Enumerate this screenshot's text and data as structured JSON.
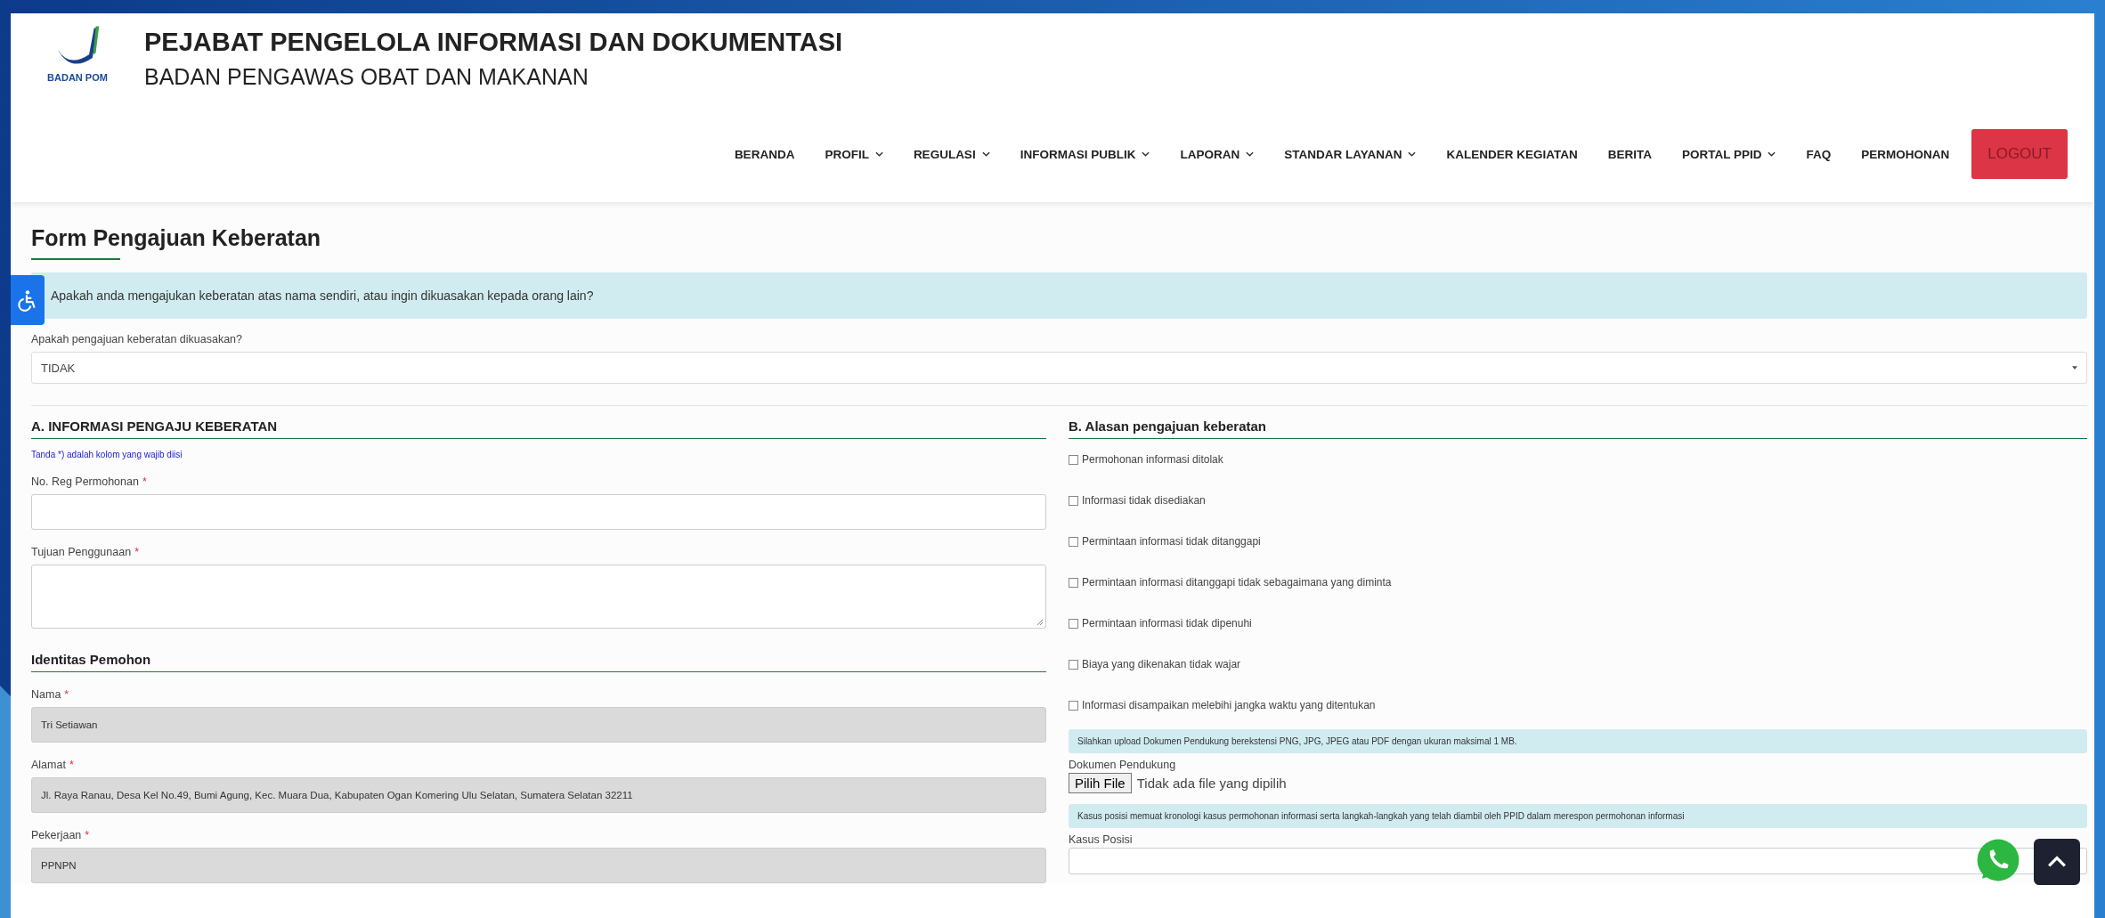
{
  "header": {
    "logo_text": "BADAN POM",
    "title": "PEJABAT PENGELOLA INFORMASI DAN DOKUMENTASI",
    "subtitle": "BADAN PENGAWAS OBAT DAN MAKANAN"
  },
  "nav": [
    {
      "label": "BERANDA",
      "dropdown": false
    },
    {
      "label": "PROFIL",
      "dropdown": true
    },
    {
      "label": "REGULASI",
      "dropdown": true
    },
    {
      "label": "INFORMASI PUBLIK",
      "dropdown": true
    },
    {
      "label": "LAPORAN",
      "dropdown": true
    },
    {
      "label": "STANDAR LAYANAN",
      "dropdown": true
    },
    {
      "label": "KALENDER KEGIATAN",
      "dropdown": false
    },
    {
      "label": "BERITA",
      "dropdown": false
    },
    {
      "label": "PORTAL PPID",
      "dropdown": true
    },
    {
      "label": "FAQ",
      "dropdown": false
    },
    {
      "label": "PERMOHONAN",
      "dropdown": false
    }
  ],
  "logout": "LOGOUT",
  "form_title": "Form Pengajuan Keberatan",
  "intro_alert": "Apakah anda mengajukan keberatan atas nama sendiri, atau ingin dikuasakan kepada orang lain?",
  "proxy_select": {
    "label": "Apakah pengajuan keberatan dikuasakan?",
    "value": "TIDAK"
  },
  "section_a": {
    "title": "A. INFORMASI PENGAJU KEBERATAN",
    "note": "Tanda *) adalah kolom yang wajib diisi",
    "fields": [
      {
        "kind": "input",
        "label": "No. Reg Permohonan",
        "required_mark": "*",
        "disabled": false
      },
      {
        "kind": "textarea",
        "label": "Tujuan Penggunaan",
        "required_mark": "*",
        "disabled": false
      },
      {
        "kind": "heading",
        "label": "Identitas Pemohon"
      },
      {
        "kind": "input",
        "label": "Nama",
        "required_mark": "*",
        "disabled": true,
        "value": "Tri Setiawan"
      },
      {
        "kind": "input",
        "label": "Alamat",
        "required_mark": "*",
        "disabled": true,
        "value": "Jl. Raya Ranau, Desa Kel No.49, Bumi Agung, Kec. Muara Dua, Kabupaten Ogan Komering Ulu Selatan, Sumatera Selatan 32211"
      },
      {
        "kind": "input",
        "label": "Pekerjaan",
        "required_mark": "*",
        "disabled": true,
        "value": "PPNPN"
      }
    ]
  },
  "section_b": {
    "title": "B. Alasan pengajuan keberatan",
    "reasons": [
      {
        "label": "Permohonan informasi ditolak",
        "checked": false
      },
      {
        "label": "Informasi tidak disediakan",
        "checked": false
      },
      {
        "label": "Permintaan informasi tidak ditanggapi",
        "checked": false
      },
      {
        "label": "Permintaan informasi ditanggapi tidak sebagaimana yang diminta",
        "checked": false
      },
      {
        "label": "Permintaan informasi tidak dipenuhi",
        "checked": false
      },
      {
        "label": "Biaya yang dikenakan tidak wajar",
        "checked": false
      },
      {
        "label": "Informasi disampaikan melebihi jangka waktu yang ditentukan",
        "checked": false
      }
    ],
    "upload_note": "Silahkan upload Dokumen Pendukung berekstensi PNG, JPG, JPEG atau PDF dengan ukuran maksimal 1 MB.",
    "upload_label": "Dokumen Pendukung",
    "upload_button": "Pilih File",
    "upload_status": "Tidak ada file yang dipilih",
    "case_note": "Kasus posisi memuat kronologi kasus permohonan informasi serta langkah-langkah yang telah diambil oleh PPID dalam merespon permohonan informasi",
    "case_label": "Kasus Posisi"
  }
}
